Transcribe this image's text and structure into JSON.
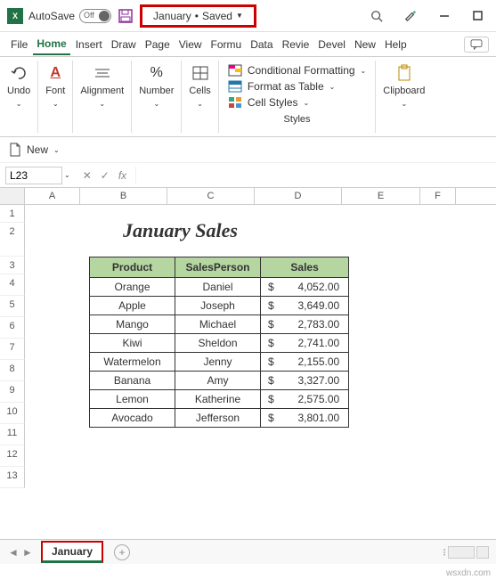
{
  "titlebar": {
    "autosave_label": "AutoSave",
    "autosave_state": "Off",
    "filename": "January",
    "save_state": "Saved"
  },
  "menu": {
    "file": "File",
    "home": "Home",
    "insert": "Insert",
    "draw": "Draw",
    "page": "Page",
    "view": "View",
    "formu": "Formu",
    "data": "Data",
    "revie": "Revie",
    "devel": "Devel",
    "new": "New",
    "help": "Help"
  },
  "ribbon": {
    "undo": "Undo",
    "font": "Font",
    "alignment": "Alignment",
    "number": "Number",
    "cells": "Cells",
    "cond_format": "Conditional Formatting",
    "format_table": "Format as Table",
    "cell_styles": "Cell Styles",
    "styles_label": "Styles",
    "clipboard": "Clipboard"
  },
  "new_bar": {
    "label": "New"
  },
  "formula_bar": {
    "cell_ref": "L23"
  },
  "columns": [
    "A",
    "B",
    "C",
    "D",
    "E",
    "F"
  ],
  "rows": [
    "1",
    "2",
    "3",
    "4",
    "5",
    "6",
    "7",
    "8",
    "9",
    "10",
    "11",
    "12",
    "13"
  ],
  "sheet": {
    "title": "January Sales",
    "headers": [
      "Product",
      "SalesPerson",
      "Sales"
    ],
    "currency": "$",
    "data": [
      {
        "product": "Orange",
        "person": "Daniel",
        "sales": "4,052.00"
      },
      {
        "product": "Apple",
        "person": "Joseph",
        "sales": "3,649.00"
      },
      {
        "product": "Mango",
        "person": "Michael",
        "sales": "2,783.00"
      },
      {
        "product": "Kiwi",
        "person": "Sheldon",
        "sales": "2,741.00"
      },
      {
        "product": "Watermelon",
        "person": "Jenny",
        "sales": "2,155.00"
      },
      {
        "product": "Banana",
        "person": "Amy",
        "sales": "3,327.00"
      },
      {
        "product": "Lemon",
        "person": "Katherine",
        "sales": "2,575.00"
      },
      {
        "product": "Avocado",
        "person": "Jefferson",
        "sales": "3,801.00"
      }
    ]
  },
  "tabs": {
    "active": "January"
  },
  "watermark": "wsxdn.com"
}
